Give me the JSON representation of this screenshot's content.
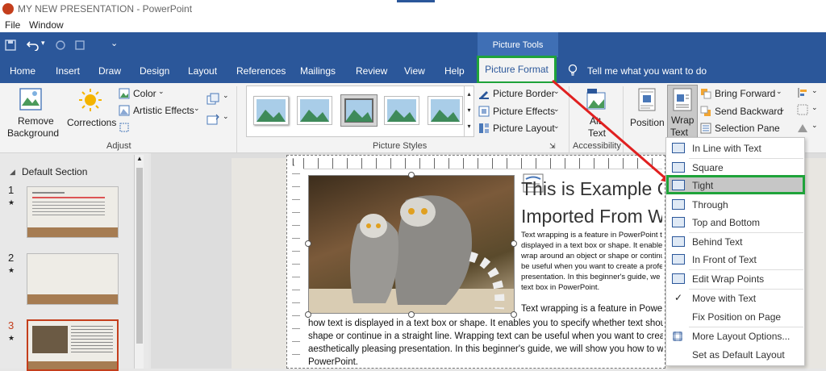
{
  "window": {
    "title": "MY NEW PRESENTATION - PowerPoint"
  },
  "menu": [
    "File",
    "Window"
  ],
  "contextual": {
    "label": "Picture Tools"
  },
  "tabs": [
    "Home",
    "Insert",
    "Draw",
    "Design",
    "Layout",
    "References",
    "Mailings",
    "Review",
    "View",
    "Help"
  ],
  "active_tab": "Picture Format",
  "tell_me": "Tell me what you want to do",
  "ribbon": {
    "remove_bg": [
      "Remove",
      "Background"
    ],
    "corrections": "Corrections",
    "color": "Color",
    "artistic": "Artistic Effects",
    "adjust": "Adjust",
    "picture_border": "Picture Border",
    "picture_effects": "Picture Effects",
    "picture_layout": "Picture Layout",
    "picture_styles": "Picture Styles",
    "alt_text": [
      "Alt",
      "Text"
    ],
    "accessibility": "Accessibility",
    "position": "Position",
    "wrap_text": [
      "Wrap",
      "Text"
    ],
    "bring_forward": "Bring Forward",
    "send_backward": "Send Backward",
    "selection_pane": "Selection Pane"
  },
  "thumbnails": {
    "section": "Default Section",
    "numbers": [
      "1",
      "2",
      "3"
    ]
  },
  "slide": {
    "title_line1": "This is Example Of",
    "title_line2": "Imported From W",
    "para1": [
      "Text wrapping is a feature in PowerPoint t",
      "displayed in a text box or shape. It enables",
      "wrap around an object or shape or continu",
      "be useful when you want to create a profe",
      "presentation. In this beginner's guide, we",
      "text box in PowerPoint."
    ],
    "para2": [
      "Text wrapping is a feature in PowerP",
      "how text is displayed in a text box or shape. It enables you to specify whether text shoul",
      "shape or continue in a straight line. Wrapping text can be useful when you want to creat",
      "aesthetically pleasing presentation. In this beginner's guide, we will show you how to wr",
      "PowerPoint."
    ]
  },
  "wrap_menu": [
    "In Line with Text",
    "Square",
    "Tight",
    "Through",
    "Top and Bottom",
    "Behind Text",
    "In Front of Text",
    "Edit Wrap Points",
    "Move with Text",
    "Fix Position on Page",
    "More Layout Options...",
    "Set as Default Layout"
  ],
  "colors": {
    "ribbon_blue": "#2b579a",
    "highlight_green": "#1fa33a",
    "annotation_red": "#e02020"
  }
}
